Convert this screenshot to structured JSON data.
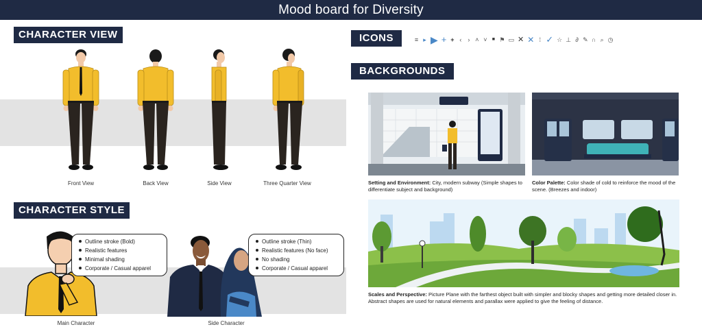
{
  "title": "Mood board for Diversity",
  "sections": {
    "character_view": "CHARACTER VIEW",
    "character_style": "CHARACTER STYLE",
    "icons": "ICONS",
    "backgrounds": "BACKGROUNDS"
  },
  "views": {
    "front": "Front View",
    "back": "Back View",
    "side": "Side View",
    "three_quarter": "Three Quarter View"
  },
  "styles": {
    "main": {
      "caption": "Main Character",
      "bullets": [
        "Outline stroke (Bold)",
        "Realistic features",
        "Minimal shading",
        "Corporate / Casual apparel"
      ]
    },
    "side": {
      "caption": "Side Character",
      "bullets": [
        "Outline stroke (Thin)",
        "Realistic features (No face)",
        "No shading",
        "Corporate / Casual apparel"
      ]
    }
  },
  "icons": [
    "menu-icon",
    "play-small-icon",
    "play-icon",
    "plus-icon",
    "plus-small-icon",
    "chevron-left-icon",
    "chevron-right-icon",
    "chevron-up-icon",
    "chevron-down-icon",
    "lock-icon",
    "bookmark-icon",
    "chat-icon",
    "close-icon",
    "close-blue-icon",
    "grip-icon",
    "check-icon",
    "star-icon",
    "download-icon",
    "link-icon",
    "edit-icon",
    "headphones-icon",
    "search-icon",
    "clock-icon"
  ],
  "backgrounds": {
    "setting": {
      "label": "Setting and Environment:",
      "text": " City, modern subway (Simple shapes to differentiate subject and background)"
    },
    "palette": {
      "label": "Color Palette:",
      "text": " Color shade of cold to reinforce the mood of the scene. (Breezes and indoor)"
    },
    "scales": {
      "label": "Scales and Perspective:",
      "text": " Picture Plane with the farthest object built with simpler and blocky shapes and getting more detailed closer in. Abstract shapes are used for natural elements and parallax were applied to give the feeling of distance."
    }
  },
  "colors": {
    "navy": "#1f2a44",
    "shirt": "#f2bd2c",
    "pants": "#2a241f",
    "accent_blue": "#4a88c7"
  }
}
